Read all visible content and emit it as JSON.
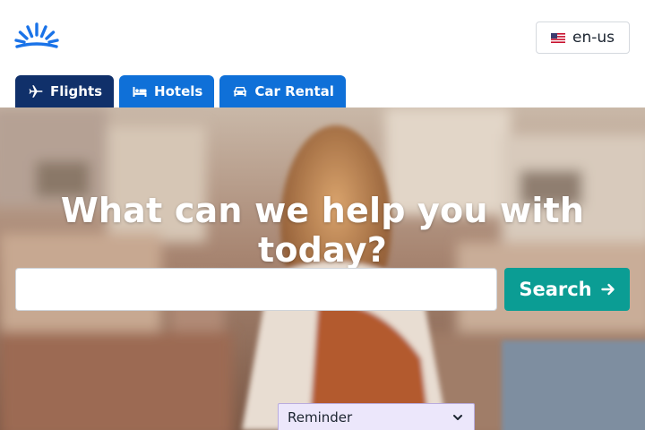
{
  "header": {
    "logo_icon": "sunrise-logo-icon",
    "language": {
      "flag_icon": "us-flag-icon",
      "label": "en-us"
    }
  },
  "tabs": [
    {
      "label": "Flights",
      "icon": "plane-icon",
      "active": true
    },
    {
      "label": "Hotels",
      "icon": "bed-icon",
      "active": false
    },
    {
      "label": "Car Rental",
      "icon": "car-icon",
      "active": false
    }
  ],
  "hero": {
    "headline": "What can we help you with today?",
    "background": "photo-woman-overlooking-city"
  },
  "search": {
    "value": "",
    "placeholder": "",
    "button_label": "Search",
    "button_icon": "arrow-right-icon"
  },
  "reminder": {
    "label": "Reminder",
    "icon": "chevron-down-icon"
  },
  "colors": {
    "logo_blue": "#1a73e8",
    "tab_active": "#10306a",
    "tab_inactive": "#0f70d8",
    "search_button": "#0b9d94",
    "reminder_bg": "#ece7fb"
  }
}
